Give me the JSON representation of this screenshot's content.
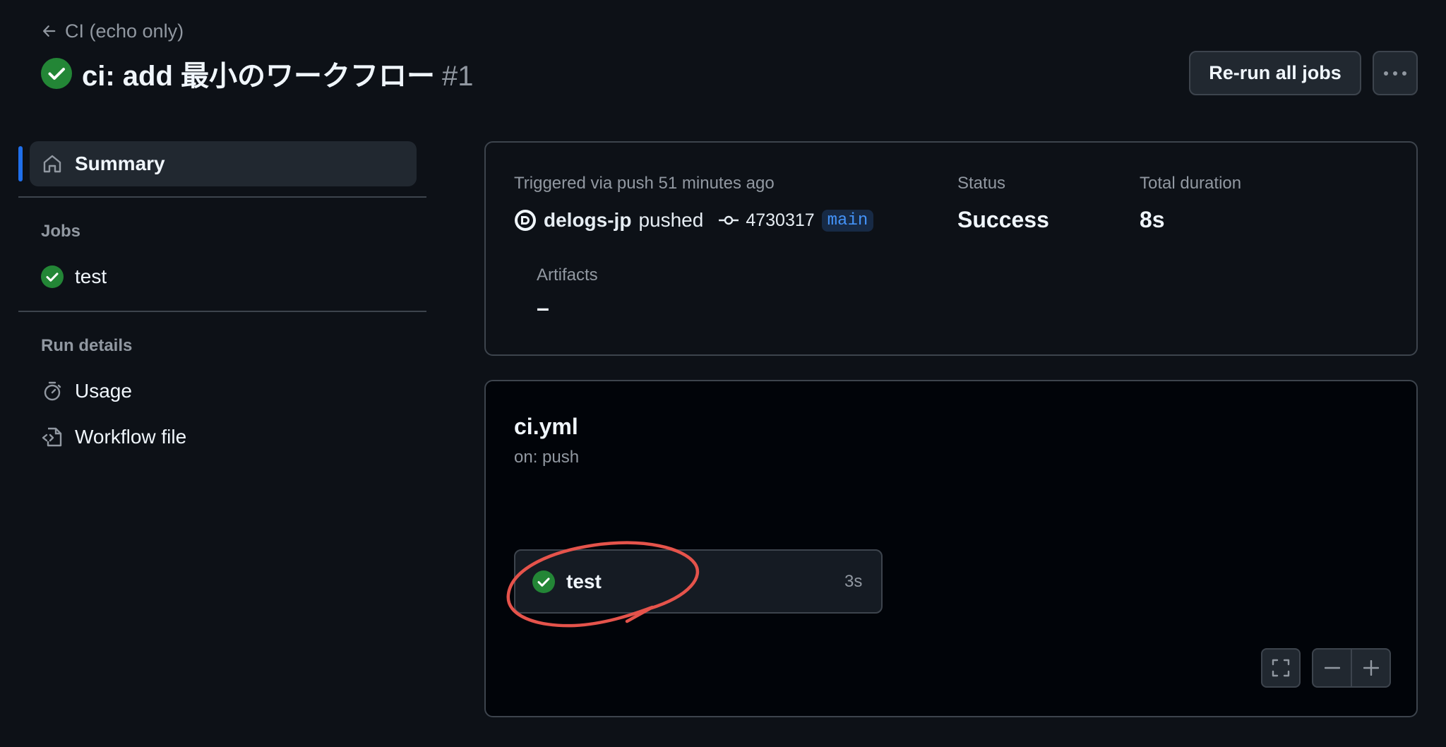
{
  "header": {
    "back_label": "CI (echo only)",
    "title": "ci: add 最小のワークフロー",
    "run_number": "#1",
    "rerun_label": "Re-run all jobs",
    "more_icon": "kebab-horizontal-icon"
  },
  "sidebar": {
    "summary_label": "Summary",
    "jobs_heading": "Jobs",
    "jobs": [
      {
        "label": "test",
        "status": "success"
      }
    ],
    "run_details_heading": "Run details",
    "usage_label": "Usage",
    "workflow_file_label": "Workflow file"
  },
  "summary": {
    "trigger_text": "Triggered via push 51 minutes ago",
    "actor": "delogs-jp",
    "action": "pushed",
    "commit_sha": "4730317",
    "branch": "main",
    "status_label": "Status",
    "status_value": "Success",
    "duration_label": "Total duration",
    "duration_value": "8s",
    "artifacts_label": "Artifacts",
    "artifacts_value": "–"
  },
  "graph": {
    "workflow_name": "ci.yml",
    "trigger": "on: push",
    "job": {
      "label": "test",
      "duration": "3s",
      "status": "success"
    }
  },
  "colors": {
    "background": "#0d1117",
    "success": "#238636",
    "accent": "#1f6feb",
    "annotation": "#e5534b"
  }
}
